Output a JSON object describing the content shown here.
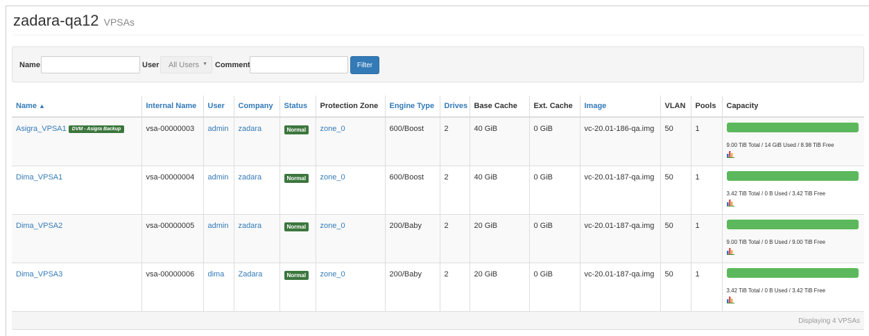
{
  "header": {
    "title": "zadara-qa12",
    "subtitle": "VPSAs"
  },
  "filter": {
    "name_label": "Name",
    "name_value": "",
    "user_label": "User",
    "user_selected": "All Users",
    "comment_label": "Comment",
    "comment_value": "",
    "filter_button": "Filter"
  },
  "table": {
    "columns": [
      "Name",
      "Internal Name",
      "User",
      "Company",
      "Status",
      "Protection Zone",
      "Engine Type",
      "Drives",
      "Base Cache",
      "Ext. Cache",
      "Image",
      "VLAN",
      "Pools",
      "Capacity"
    ],
    "sort_indicator": "▲",
    "rows": [
      {
        "name": "Asigra_VPSA1",
        "badge": "DVM - Asigra Backup",
        "internal": "vsa-00000003",
        "user": "admin",
        "company": "zadara",
        "status": "Normal",
        "zone": "zone_0",
        "engine": "600/Boost",
        "drives": "2",
        "base_cache": "40 GiB",
        "ext_cache": "0 GiB",
        "image": "vc-20.01-186-qa.img",
        "vlan": "50",
        "pools": "1",
        "capacity_text": "9.00 TiB Total / 14 GiB Used / 8.98 TiB Free"
      },
      {
        "name": "Dima_VPSA1",
        "internal": "vsa-00000004",
        "user": "admin",
        "company": "zadara",
        "status": "Normal",
        "zone": "zone_0",
        "engine": "600/Boost",
        "drives": "2",
        "base_cache": "40 GiB",
        "ext_cache": "0 GiB",
        "image": "vc-20.01-187-qa.img",
        "vlan": "50",
        "pools": "1",
        "capacity_text": "3.42 TiB Total / 0 B Used / 3.42 TiB Free"
      },
      {
        "name": "Dima_VPSA2",
        "internal": "vsa-00000005",
        "user": "admin",
        "company": "zadara",
        "status": "Normal",
        "zone": "zone_0",
        "engine": "200/Baby",
        "drives": "2",
        "base_cache": "20 GiB",
        "ext_cache": "0 GiB",
        "image": "vc-20.01-187-qa.img",
        "vlan": "50",
        "pools": "1",
        "capacity_text": "9.00 TiB Total / 0 B Used / 9.00 TiB Free"
      },
      {
        "name": "Dima_VPSA3",
        "internal": "vsa-00000006",
        "user": "dima",
        "company": "Zadara",
        "status": "Normal",
        "zone": "zone_0",
        "engine": "200/Baby",
        "drives": "2",
        "base_cache": "20 GiB",
        "ext_cache": "0 GiB",
        "image": "vc-20.01-187-qa.img",
        "vlan": "50",
        "pools": "1",
        "capacity_text": "3.42 TiB Total / 0 B Used / 3.42 TiB Free"
      }
    ],
    "footer": "Displaying 4 VPSAs"
  },
  "colors": {
    "link": "#337ab7",
    "status_green": "#3c763d",
    "capacity_green": "#5cb85c",
    "filter_button": "#337ab7"
  },
  "icons": {
    "sort": "sort-ascending-icon",
    "chart": "bar-chart-icon",
    "dropdown": "chevron-down-icon"
  }
}
